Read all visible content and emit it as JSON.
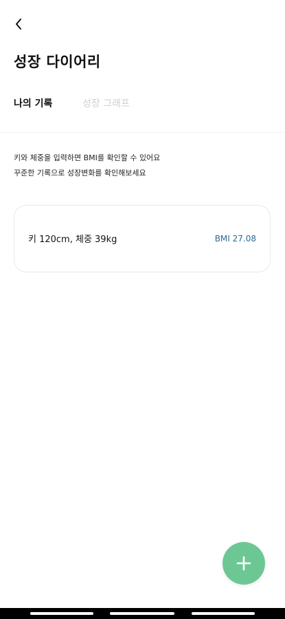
{
  "header": {
    "back_icon": "chevron-left-icon",
    "title": "성장 다이어리"
  },
  "tabs": [
    {
      "label": "나의 기록",
      "active": true
    },
    {
      "label": "성장 그래프",
      "active": false
    }
  ],
  "info": {
    "line1": "키와 체중을 입력하면 BMI를 확인할 수 있어요",
    "line2": "꾸준한 기록으로 성장변화를 확인해보세요"
  },
  "records": [
    {
      "summary": "키 120cm, 체중 39kg",
      "bmi": "BMI 27.08"
    }
  ],
  "fab": {
    "icon": "plus-icon",
    "color": "#6dc794"
  },
  "colors": {
    "accent": "#6dc794",
    "bmi_text": "#2e6b95",
    "inactive_tab": "#cfcfcf"
  }
}
